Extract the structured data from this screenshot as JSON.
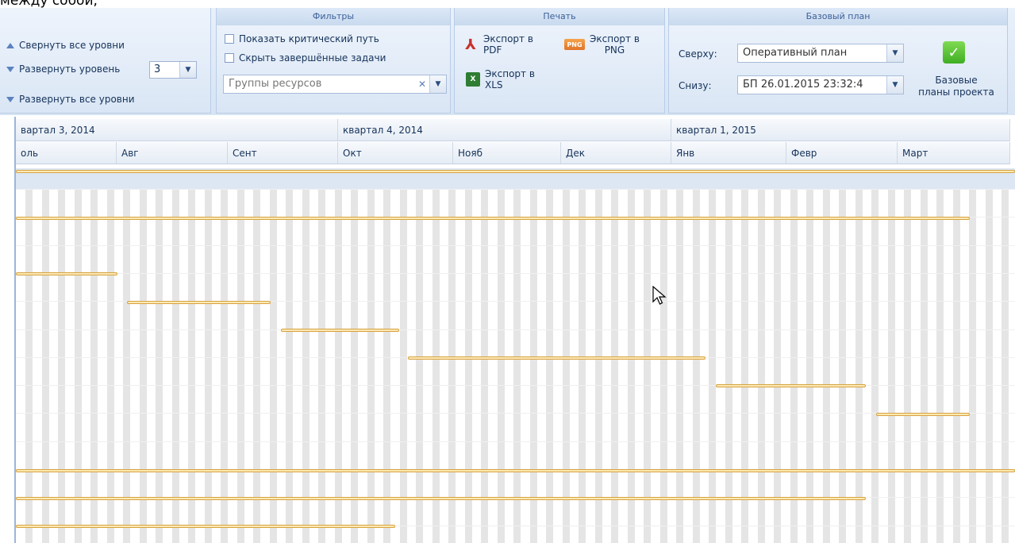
{
  "page_top_text": "между собой,",
  "ribbon": {
    "levels": {
      "collapse_all": "Свернуть все уровни",
      "expand_level": "Развернуть уровень",
      "expand_level_value": "3",
      "expand_all": "Развернуть все уровни"
    },
    "filters": {
      "title": "Фильтры",
      "show_critical_path": "Показать критический путь",
      "hide_completed": "Скрыть завершённые задачи",
      "resource_groups_placeholder": "Группы ресурсов"
    },
    "print": {
      "title": "Печать",
      "export_pdf": [
        "Экспорт в",
        "PDF"
      ],
      "export_png": [
        "Экспорт в",
        "PNG"
      ],
      "export_xls": [
        "Экспорт в",
        "XLS"
      ]
    },
    "baseline": {
      "title": "Базовый план",
      "top_label": "Сверху:",
      "top_value": "Оперативный план",
      "bottom_label": "Снизу:",
      "bottom_value": "БП 26.01.2015 23:32:4",
      "project_baselines": [
        "Базовые",
        "планы проекта"
      ]
    }
  },
  "timeline": {
    "quarters": [
      "вартал 3, 2014",
      "квартал 4, 2014",
      "квартал 1, 2015"
    ],
    "months": [
      "оль",
      "Авг",
      "Сент",
      "Окт",
      "Нояб",
      "Дек",
      "Янв",
      "Февр",
      "Март"
    ]
  },
  "colors": {
    "bar_border": "#d8a241",
    "bar_fill": "#fbe9b4",
    "header_blue": "#15325a"
  }
}
